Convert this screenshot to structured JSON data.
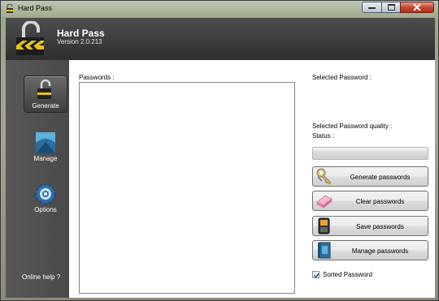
{
  "window": {
    "title": "Hard Pass"
  },
  "header": {
    "app_name": "Hard Pass",
    "version": "Version 2.0.213"
  },
  "sidebar": {
    "items": [
      {
        "label": "Generate",
        "icon": "padlock-icon",
        "active": true
      },
      {
        "label": "Manage",
        "icon": "picture-icon",
        "active": false
      },
      {
        "label": "Options",
        "icon": "gear-icon",
        "active": false
      }
    ],
    "online_help": "Online help ?"
  },
  "main": {
    "passwords_label": "Passwords :",
    "selected_label": "Selected Password :",
    "quality_label": "Selected Password quality :",
    "status_label": "Status :",
    "progress": 0,
    "buttons": {
      "generate": "Generate passwords",
      "clear": "Clear passwords",
      "save": "Save passwords",
      "manage": "Manage passwords"
    },
    "sorted_label": "Sorted Password",
    "sorted_checked": true
  }
}
